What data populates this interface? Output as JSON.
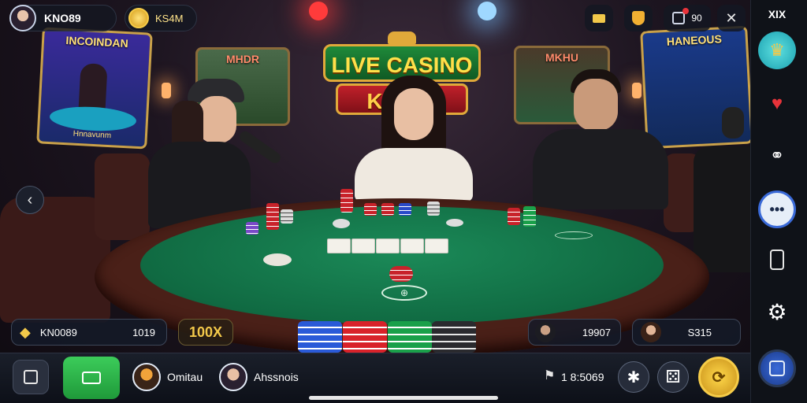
{
  "colors": {
    "felt": "#106a42",
    "gold": "#f0c43a",
    "accent_green": "#2eaa4a",
    "panel": "#141a28"
  },
  "top_left": {
    "avatar_icon": "user-avatar-icon",
    "username": "KNO89",
    "coin_icon": "gold-coin-icon",
    "coin_label": "KS4M"
  },
  "top_icons": {
    "ticket_icon": "ticket-icon",
    "trophy_icon": "trophy-icon",
    "chat_icon": "chat-notification-icon",
    "count": "90",
    "close_icon": "close-icon"
  },
  "sign": {
    "line1": "LIVE CASINO",
    "line2": "KA  NO"
  },
  "screens": {
    "left_title": "INCOINDAN",
    "left_footer": "Hnnavunm",
    "center_left": "MHDR",
    "center_right": "MKHU",
    "right_title": "HANEOUS"
  },
  "table": {
    "center_marker": "⊕"
  },
  "bottom_info": {
    "player_chip_icon": "diamond-chip-icon",
    "player_label": "KN0089",
    "player_value": "1019",
    "multiplier": "100X",
    "seat_a_value": "19907",
    "seat_b_value": "S315"
  },
  "bottom_bar": {
    "edit_icon": "edit-icon",
    "cash_icon": "cash-icon",
    "user1_name": "Omitau",
    "user2_name": "Ahssnois",
    "balance_icon": "flag-icon",
    "balance": "1 8:5069",
    "action_icon": "star-icon",
    "dice_icon": "dice-icon",
    "bet_icon": "bet-coin-icon"
  },
  "right_bar": {
    "header": "XIX",
    "icons": [
      "crown-icon",
      "heart-notification-icon",
      "friends-icon",
      "chat-bubble-icon",
      "phone-icon",
      "gear-icon",
      "cards-menu-icon"
    ]
  }
}
